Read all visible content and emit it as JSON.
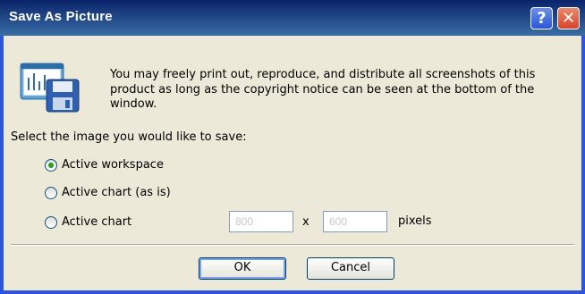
{
  "window": {
    "title": "Save As Picture",
    "help_glyph": "?",
    "close_glyph": "✕"
  },
  "notice": {
    "text": "You may freely print out, reproduce, and distribute all screenshots of this product as long as the copyright notice can be seen at the bottom of the window.",
    "icon": "save-chart-icon"
  },
  "options": {
    "prompt": "Select the image you would like to save:",
    "items": [
      {
        "label": "Active workspace",
        "selected": true
      },
      {
        "label": "Active chart (as is)",
        "selected": false
      },
      {
        "label": "Active chart",
        "selected": false
      }
    ],
    "width_value": "800",
    "height_value": "600",
    "times_label": "x",
    "pixels_label": "pixels"
  },
  "buttons": {
    "ok": "OK",
    "cancel": "Cancel"
  },
  "colors": {
    "titlebar": "#0a246a",
    "window_bg": "#ece9d8",
    "radio_dot": "#21a121"
  }
}
